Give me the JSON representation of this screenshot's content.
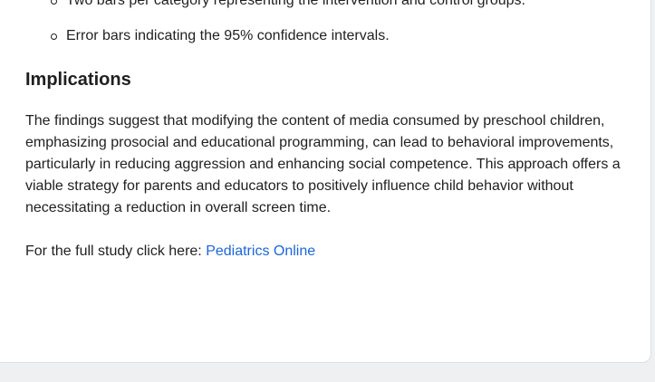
{
  "list": {
    "items": [
      {
        "text": "Two bars per category representing the intervention and control groups."
      },
      {
        "text": "Error bars indicating the 95% confidence intervals."
      }
    ]
  },
  "implications": {
    "heading": "Implications",
    "paragraph": "The findings suggest that modifying the content of media consumed by preschool children, emphasizing prosocial and educational programming, can lead to behavioral improvements, particularly in reducing aggression and enhancing social competence. This approach offers a viable strategy for parents and educators to positively influence child behavior without necessitating a reduction in overall screen time."
  },
  "study": {
    "prefix": "For the full study click here: ",
    "link_text": "Pediatrics Online",
    "link_color": "#1a66d9"
  },
  "colors": {
    "text": "#1f1f1f",
    "background": "#ffffff",
    "page_background": "#eef0f1"
  }
}
